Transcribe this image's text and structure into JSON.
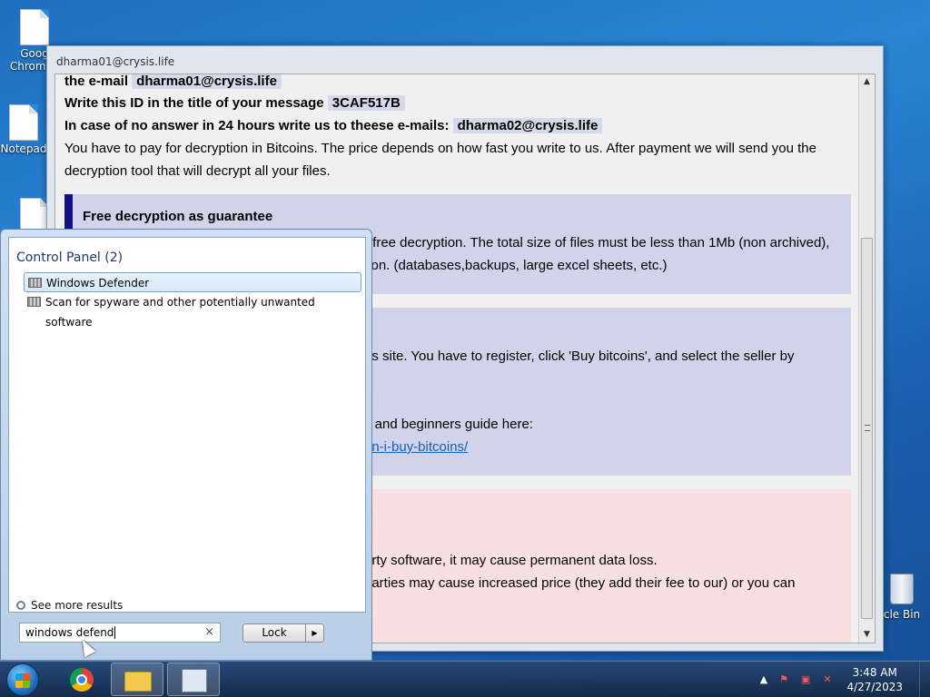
{
  "desktop": {
    "icons": [
      {
        "label": "Goog Chrome.l"
      },
      {
        "label": "Notepad"
      }
    ],
    "recycle_bin": "cle Bin"
  },
  "ransom_window": {
    "title": "dharma01@crysis.life",
    "lines": {
      "email_prefix": "the e-mail",
      "email": "dharma01@crysis.life",
      "id_prefix": "Write this ID in the title of your message",
      "id": "3CAF517B",
      "backup_prefix": "In case of no answer in 24 hours write us to theese e-mails:",
      "backup_email": "dharma02@crysis.life",
      "pay_1": "You have to pay for decryption in Bitcoins. The price depends on how fast you write to us. After payment we will send you the",
      "pay_2": "decryption tool that will decrypt all your files."
    },
    "guarantee_box": {
      "title": "Free decryption as guarantee",
      "line1": "r free decryption. The total size of files must be less than 1Mb (non archived),",
      "line2": "tion. (databases,backups, large excel sheets, etc.)"
    },
    "bitcoin_box": {
      "line1": "ns site. You have to register, click 'Buy bitcoins', and select the seller by",
      "line2": "s and beginners guide here:",
      "link": "an-i-buy-bitcoins/"
    },
    "warning_box": {
      "line1": "arty software, it may cause permanent data loss.",
      "line2": "parties may cause increased price (they add their fee to our) or you can"
    }
  },
  "start_menu": {
    "heading": "Control Panel (2)",
    "results": [
      {
        "label": "Windows Defender",
        "selected": true
      },
      {
        "label": "Scan for spyware and other potentially unwanted software",
        "selected": false
      }
    ],
    "see_more": "See more results",
    "search_value": "windows defend",
    "clear_symbol": "×",
    "power_button": "Lock",
    "power_arrow": "▶"
  },
  "taskbar": {
    "time": "3:48 AM",
    "date": "4/27/2023"
  }
}
